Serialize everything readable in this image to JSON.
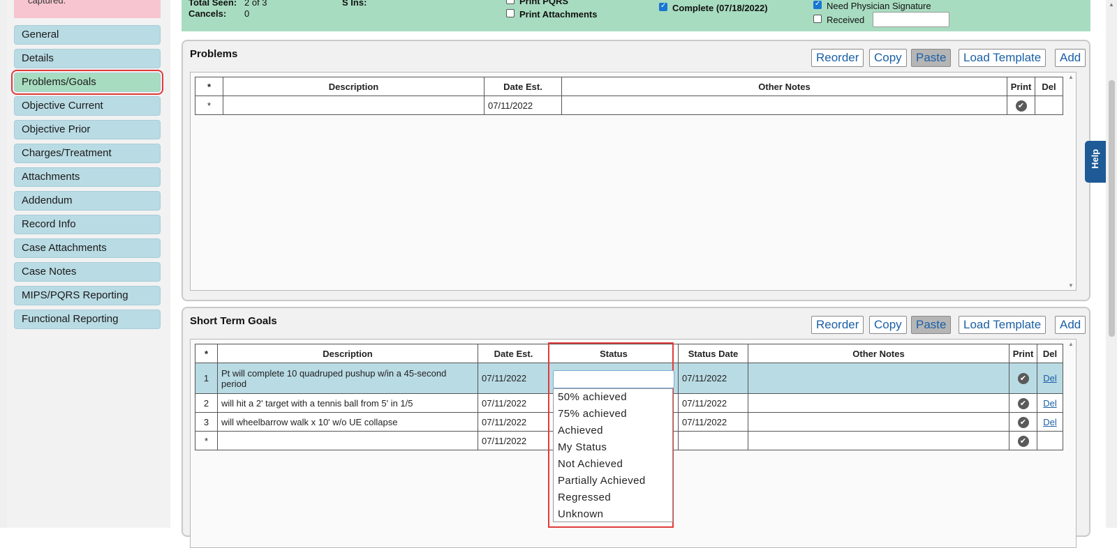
{
  "alert_text": "captured.",
  "sidebar": {
    "items": [
      {
        "label": "General"
      },
      {
        "label": "Details"
      },
      {
        "label": "Problems/Goals",
        "active": true
      },
      {
        "label": "Objective Current"
      },
      {
        "label": "Objective Prior"
      },
      {
        "label": "Charges/Treatment"
      },
      {
        "label": "Attachments"
      },
      {
        "label": "Addendum"
      },
      {
        "label": "Record Info"
      },
      {
        "label": "Case Attachments"
      },
      {
        "label": "Case Notes"
      },
      {
        "label": "MIPS/PQRS Reporting"
      },
      {
        "label": "Functional Reporting"
      }
    ]
  },
  "header": {
    "total_seen_label": "Total Seen:",
    "total_seen_value": "2 of 3",
    "cancels_label": "Cancels:",
    "cancels_value": "0",
    "s_ins_label": "S Ins:",
    "print_pqrs_label": "Print PQRS",
    "print_attachments_label": "Print Attachments",
    "complete_label": "Complete (07/18/2022)",
    "need_signature_label": "Need Physician Signature",
    "received_label": "Received",
    "received_value": ""
  },
  "buttons": {
    "reorder": "Reorder",
    "copy": "Copy",
    "paste": "Paste",
    "load_template": "Load Template",
    "add": "Add"
  },
  "problems": {
    "title": "Problems",
    "columns": {
      "star": "*",
      "description": "Description",
      "date_est": "Date Est.",
      "other_notes": "Other Notes",
      "print": "Print",
      "del": "Del"
    },
    "new_row": {
      "num": "*",
      "description": "",
      "date_est": "07/11/2022",
      "other_notes": ""
    }
  },
  "stg": {
    "title": "Short Term Goals",
    "columns": {
      "star": "*",
      "description": "Description",
      "date_est": "Date Est.",
      "status": "Status",
      "status_date": "Status Date",
      "other_notes": "Other Notes",
      "print": "Print",
      "del": "Del"
    },
    "rows": [
      {
        "num": "1",
        "description": "Pt will complete 10 quadruped pushup w/in a 45-second period",
        "date_est": "07/11/2022",
        "status": "",
        "status_date": "07/11/2022",
        "other_notes": "",
        "del": "Del"
      },
      {
        "num": "2",
        "description": "will hit a 2' target with a tennis ball from 5' in 1/5",
        "date_est": "07/11/2022",
        "status": "",
        "status_date": "07/11/2022",
        "other_notes": "",
        "del": "Del"
      },
      {
        "num": "3",
        "description": "will wheelbarrow walk x 10' w/o UE collapse",
        "date_est": "07/11/2022",
        "status": "",
        "status_date": "07/11/2022",
        "other_notes": "",
        "del": "Del"
      },
      {
        "num": "*",
        "description": "",
        "date_est": "07/11/2022",
        "status": "",
        "status_date": "",
        "other_notes": "",
        "del": ""
      }
    ]
  },
  "status_dropdown": {
    "options": [
      "50% achieved",
      "75% achieved",
      "Achieved",
      "My Status",
      "Not Achieved",
      "Partially Achieved",
      "Regressed",
      "Unknown"
    ]
  },
  "help_label": "Help"
}
